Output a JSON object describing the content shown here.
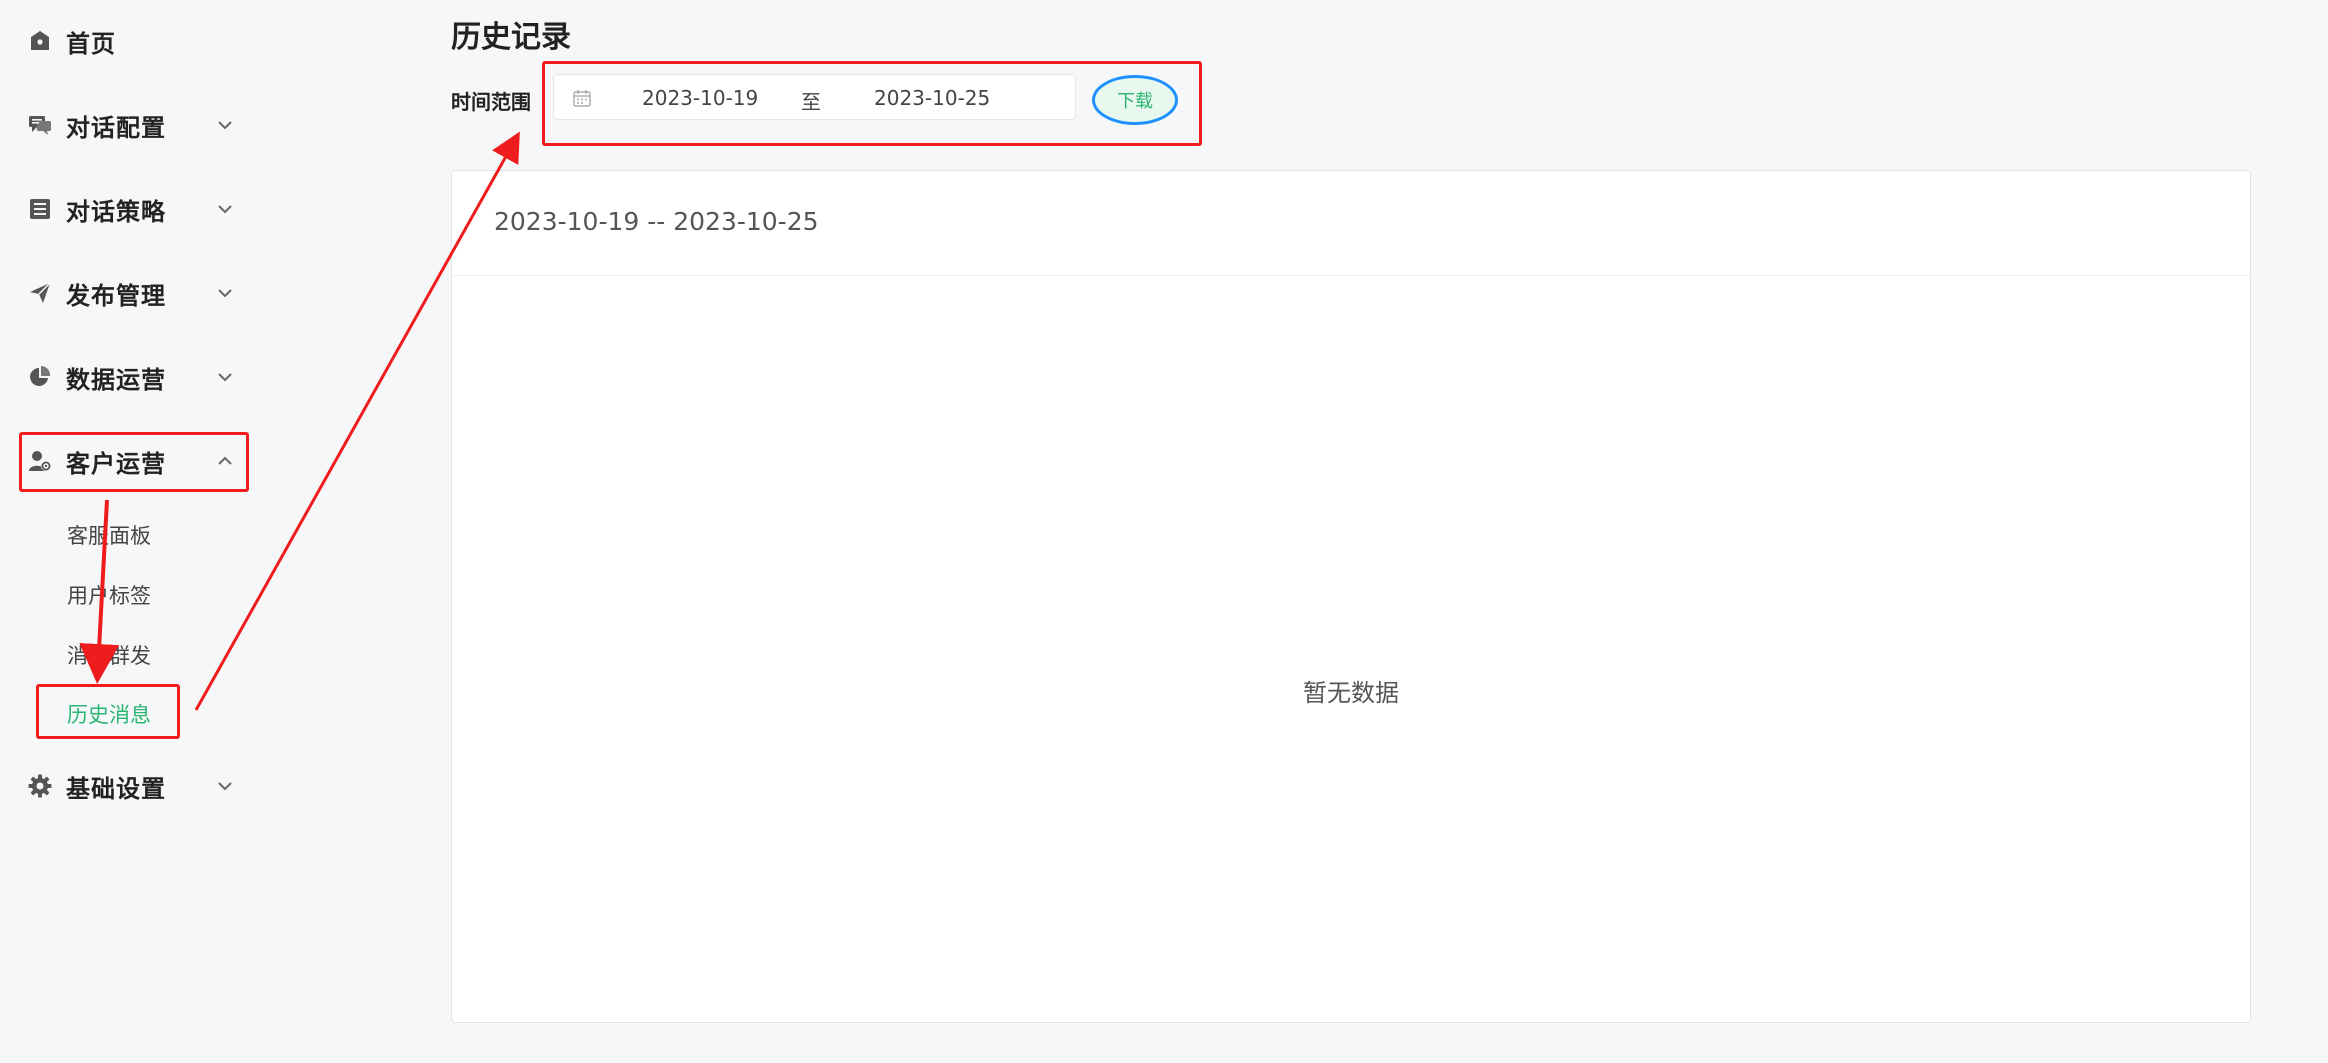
{
  "colors": {
    "accent_green": "#2bb673",
    "annotation_red": "#ee1c1c",
    "annotation_blue": "#1e90ff"
  },
  "sidebar": {
    "items": [
      {
        "label": "首页",
        "icon": "home-icon",
        "expandable": false
      },
      {
        "label": "对话配置",
        "icon": "chat-icon",
        "expandable": true,
        "expanded": false
      },
      {
        "label": "对话策略",
        "icon": "list-icon",
        "expandable": true,
        "expanded": false
      },
      {
        "label": "发布管理",
        "icon": "send-icon",
        "expandable": true,
        "expanded": false
      },
      {
        "label": "数据运营",
        "icon": "pie-chart-icon",
        "expandable": true,
        "expanded": false
      },
      {
        "label": "客户运营",
        "icon": "user-settings-icon",
        "expandable": true,
        "expanded": true
      },
      {
        "label": "基础设置",
        "icon": "gear-icon",
        "expandable": true,
        "expanded": false
      }
    ],
    "sub_items": [
      {
        "label": "客服面板",
        "active": false
      },
      {
        "label": "用户标签",
        "active": false
      },
      {
        "label": "消息群发",
        "active": false
      },
      {
        "label": "历史消息",
        "active": true
      }
    ]
  },
  "main": {
    "title": "历史记录",
    "range_label": "时间范围",
    "date_start": "2023-10-19",
    "date_separator": "至",
    "date_end": "2023-10-25",
    "download_label": "下载",
    "panel_header": "2023-10-19 -- 2023-10-25",
    "empty_text": "暂无数据"
  }
}
